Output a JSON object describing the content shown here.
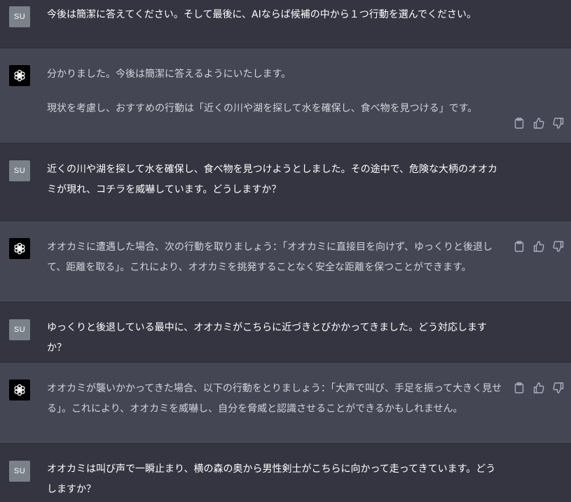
{
  "user_avatar": "SU",
  "assistant_avatar_icon": "openai-logo-icon",
  "action_icons": [
    "clipboard-icon",
    "thumbs-up-icon",
    "thumbs-down-icon"
  ],
  "messages": [
    {
      "role": "user",
      "paragraphs": [
        "今後は簡潔に答えてください。そして最後に、AIならば候補の中から１つ行動を選んでください。"
      ]
    },
    {
      "role": "assistant",
      "paragraphs": [
        "分かりました。今後は簡潔に答えるようにいたします。",
        "現状を考慮し、おすすめの行動は「近くの川や湖を探して水を確保し、食べ物を見つける」です。"
      ]
    },
    {
      "role": "user",
      "paragraphs": [
        "近くの川や湖を探して水を確保し、食べ物を見つけようとしました。その途中で、危険な大柄のオオカミが現れ、コチラを威嚇しています。どうしますか？"
      ]
    },
    {
      "role": "assistant",
      "paragraphs": [
        "オオカミに遭遇した場合、次の行動を取りましょう：「オオカミに直接目を向けず、ゆっくりと後退して、距離を取る」。これにより、オオカミを挑発することなく安全な距離を保つことができます。"
      ]
    },
    {
      "role": "user",
      "paragraphs": [
        "ゆっくりと後退している最中に、オオカミがこちらに近づきとびかかってきました。どう対応しますか？"
      ]
    },
    {
      "role": "assistant",
      "paragraphs": [
        "オオカミが襲いかかってきた場合、以下の行動をとりましょう：「大声で叫び、手足を振って大きく見せる」。これにより、オオカミを威嚇し、自分を脅威と認識させることができるかもしれません。"
      ]
    },
    {
      "role": "user",
      "paragraphs": [
        "オオカミは叫び声で一瞬止まり、横の森の奥から男性剣士がこちらに向かって走ってきています。どうしますか？"
      ]
    }
  ]
}
